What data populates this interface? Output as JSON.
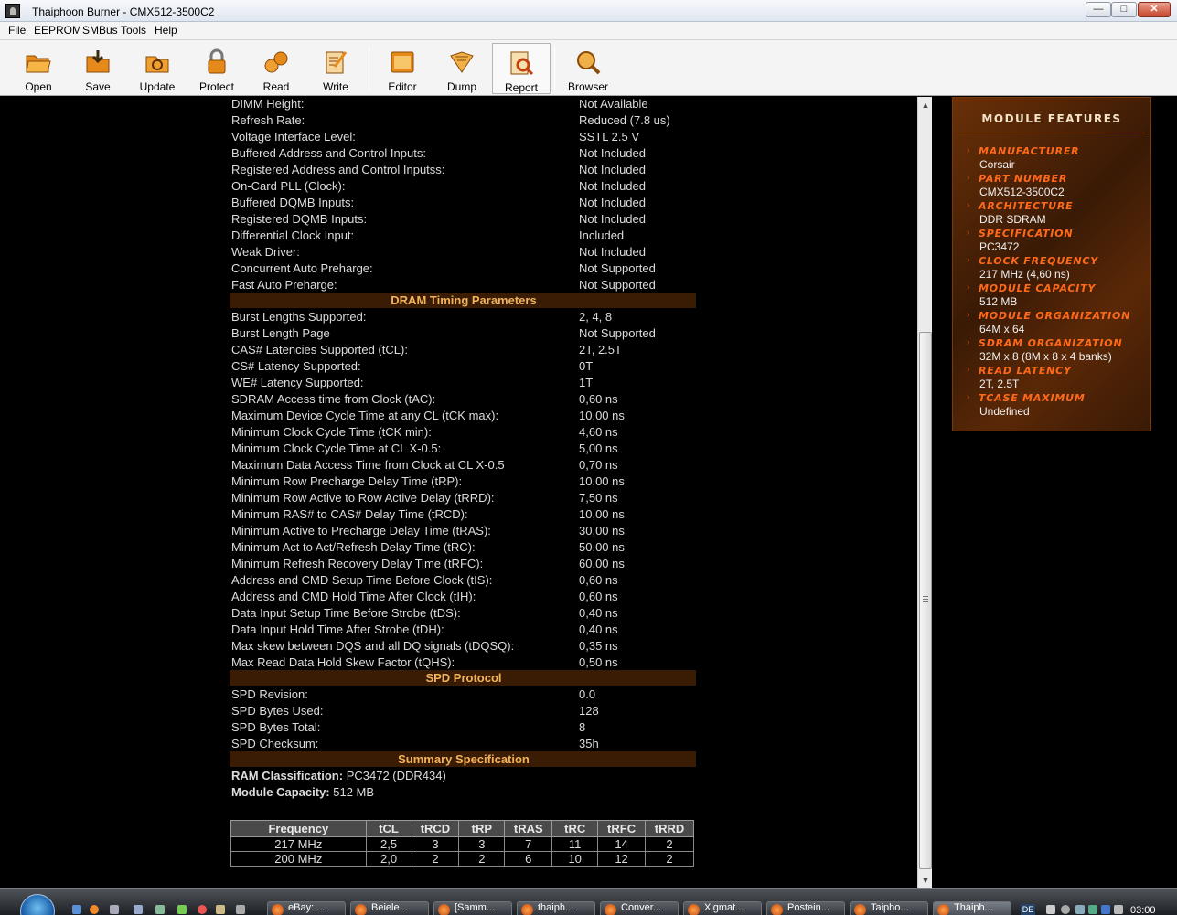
{
  "window": {
    "title": "Thaiphoon Burner - CMX512-3500C2"
  },
  "menu": [
    "File",
    "EEPROM",
    "SMBus",
    "Tools",
    "Help"
  ],
  "toolbar": [
    "Open",
    "Save",
    "Update",
    "Protect",
    "Read",
    "Write",
    "Editor",
    "Dump",
    "Report",
    "Browser"
  ],
  "report": {
    "general_rows": [
      [
        "DIMM Height:",
        "Not Available"
      ],
      [
        "Refresh Rate:",
        "Reduced (7.8 us)"
      ],
      [
        "Voltage Interface Level:",
        "SSTL 2.5 V"
      ],
      [
        "Buffered Address and Control Inputs:",
        "Not Included"
      ],
      [
        "Registered Address and Control Inputss:",
        "Not Included"
      ],
      [
        "On-Card PLL (Clock):",
        "Not Included"
      ],
      [
        "Buffered DQMB Inputs:",
        "Not Included"
      ],
      [
        "Registered DQMB Inputs:",
        "Not Included"
      ],
      [
        "Differential Clock Input:",
        "Included"
      ],
      [
        "Weak Driver:",
        "Not Included"
      ],
      [
        "Concurrent Auto Preharge:",
        "Not Supported"
      ],
      [
        "Fast Auto Preharge:",
        "Not Supported"
      ]
    ],
    "timing_header": "DRAM Timing Parameters",
    "timing_rows": [
      [
        "Burst Lengths Supported:",
        "2, 4, 8"
      ],
      [
        "Burst Length Page",
        "Not Supported"
      ],
      [
        "CAS# Latencies Supported (tCL):",
        "2T, 2.5T"
      ],
      [
        "CS# Latency Supported:",
        "0T"
      ],
      [
        "WE# Latency Supported:",
        "1T"
      ],
      [
        "SDRAM Access time from Clock (tAC):",
        "0,60 ns"
      ],
      [
        "Maximum Device Cycle Time at any CL (tCK max):",
        "10,00 ns"
      ],
      [
        "Minimum Clock Cycle Time (tCK min):",
        "4,60 ns"
      ],
      [
        "Minimum Clock Cycle Time at CL X-0.5:",
        "5,00 ns"
      ],
      [
        "Maximum Data Access Time from Clock at CL X-0.5",
        "0,70 ns"
      ],
      [
        "Minimum Row Precharge Delay Time (tRP):",
        "10,00 ns"
      ],
      [
        "Minimum Row Active to Row Active Delay (tRRD):",
        "7,50 ns"
      ],
      [
        "Minimum RAS# to CAS# Delay Time (tRCD):",
        "10,00 ns"
      ],
      [
        "Minimum Active to Precharge Delay Time (tRAS):",
        "30,00 ns"
      ],
      [
        "Minimum Act to Act/Refresh Delay Time (tRC):",
        "50,00 ns"
      ],
      [
        "Minimum Refresh Recovery Delay Time (tRFC):",
        "60,00 ns"
      ],
      [
        "Address and CMD Setup Time Before Clock (tIS):",
        "0,60 ns"
      ],
      [
        "Address and CMD Hold Time After Clock (tIH):",
        "0,60 ns"
      ],
      [
        "Data Input Setup Time Before Strobe (tDS):",
        "0,40 ns"
      ],
      [
        "Data Input Hold Time After Strobe (tDH):",
        "0,40 ns"
      ],
      [
        "Max skew between DQS and all DQ signals (tDQSQ):",
        "0,35 ns"
      ],
      [
        "Max Read Data Hold Skew Factor (tQHS):",
        "0,50 ns"
      ]
    ],
    "spd_header": "SPD Protocol",
    "spd_rows": [
      [
        "SPD Revision:",
        "0.0"
      ],
      [
        "SPD Bytes Used:",
        "128"
      ],
      [
        "SPD Bytes Total:",
        "8"
      ],
      [
        "SPD Checksum:",
        "35h"
      ]
    ],
    "summary_header": "Summary Specification",
    "summary": [
      {
        "label": "RAM Classification",
        "value": "PC3472 (DDR434)"
      },
      {
        "label": "Module Capacity",
        "value": "512 MB"
      }
    ],
    "freq_table": {
      "headers": [
        "Frequency",
        "tCL",
        "tRCD",
        "tRP",
        "tRAS",
        "tRC",
        "tRFC",
        "tRRD"
      ],
      "rows": [
        [
          "217 MHz",
          "2,5",
          "3",
          "3",
          "7",
          "11",
          "14",
          "2"
        ],
        [
          "200 MHz",
          "2,0",
          "2",
          "2",
          "6",
          "10",
          "12",
          "2"
        ]
      ]
    }
  },
  "features": {
    "title": "MODULE FEATURES",
    "items": [
      {
        "label": "MANUFACTURER",
        "value": "Corsair"
      },
      {
        "label": "PART NUMBER",
        "value": "CMX512-3500C2"
      },
      {
        "label": "ARCHITECTURE",
        "value": "DDR SDRAM"
      },
      {
        "label": "SPECIFICATION",
        "value": "PC3472"
      },
      {
        "label": "CLOCK FREQUENCY",
        "value": "217 MHz (4,60 ns)"
      },
      {
        "label": "MODULE CAPACITY",
        "value": "512 MB"
      },
      {
        "label": "MODULE ORGANIZATION",
        "value": "64M x 64"
      },
      {
        "label": "SDRAM ORGANIZATION",
        "value": "32M x 8 (8M x 8 x 4 banks)"
      },
      {
        "label": "READ LATENCY",
        "value": "2T, 2.5T"
      },
      {
        "label": "TCASE MAXIMUM",
        "value": "Undefined"
      }
    ]
  },
  "taskbar": {
    "tasks": [
      "eBay: ...",
      "Beiele...",
      "[Samm...",
      "thaiph...",
      "Conver...",
      "Xigmat...",
      "Postein...",
      "Taipho...",
      "Thaiph..."
    ],
    "language": "DE",
    "clock": "03:00"
  }
}
